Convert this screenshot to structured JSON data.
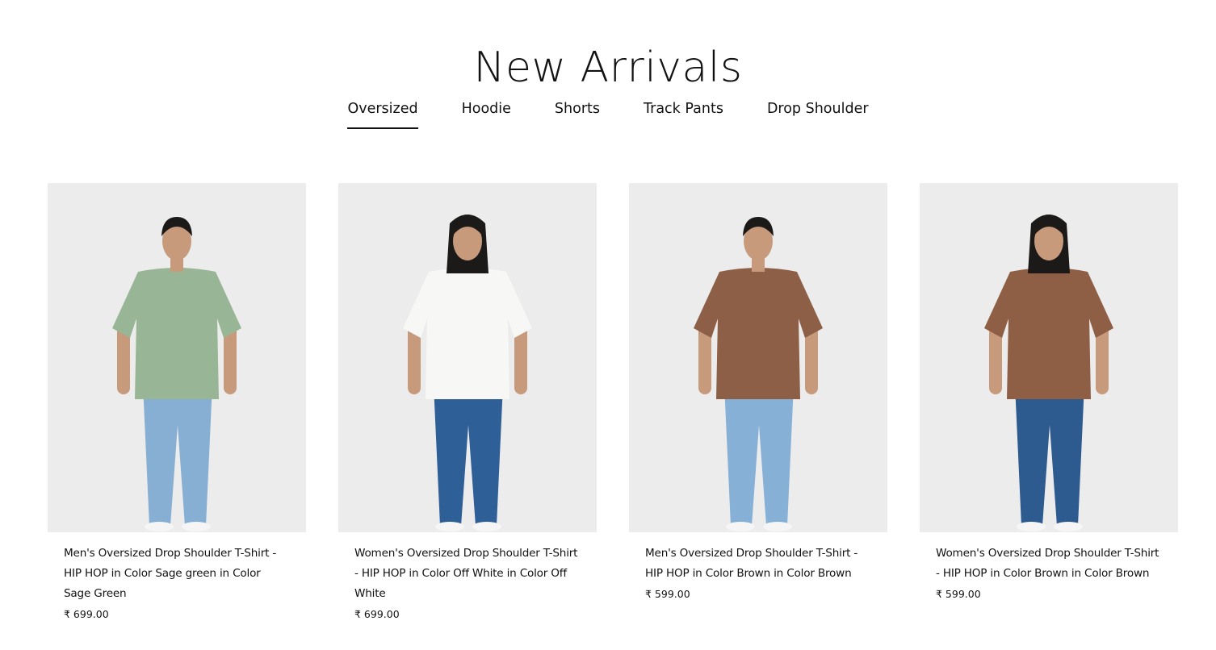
{
  "section": {
    "title": "New Arrivals"
  },
  "tabs": [
    {
      "label": "Oversized",
      "active": true
    },
    {
      "label": "Hoodie",
      "active": false
    },
    {
      "label": "Shorts",
      "active": false
    },
    {
      "label": "Track Pants",
      "active": false
    },
    {
      "label": "Drop Shoulder",
      "active": false
    }
  ],
  "products": [
    {
      "title": "Men's Oversized Drop Shoulder T-Shirt - HIP HOP in Color Sage green in Color Sage Green",
      "price": "₹ 699.00",
      "shirt_color": "#98b595",
      "jeans_color": "#86afd3",
      "hair": "short"
    },
    {
      "title": "Women's Oversized Drop Shoulder T-Shirt - HIP HOP in Color Off White in Color Off White",
      "price": "₹ 699.00",
      "shirt_color": "#f7f7f5",
      "jeans_color": "#2f5f97",
      "hair": "long"
    },
    {
      "title": "Men's Oversized Drop Shoulder T-Shirt - HIP HOP in Color Brown in Color Brown",
      "price": "₹ 599.00",
      "shirt_color": "#8c5f46",
      "jeans_color": "#86b0d6",
      "hair": "short"
    },
    {
      "title": "Women's Oversized Drop Shoulder T-Shirt - HIP HOP in Color Brown in Color Brown",
      "price": "₹ 599.00",
      "shirt_color": "#8e5f45",
      "jeans_color": "#2d5a8f",
      "hair": "long"
    }
  ]
}
